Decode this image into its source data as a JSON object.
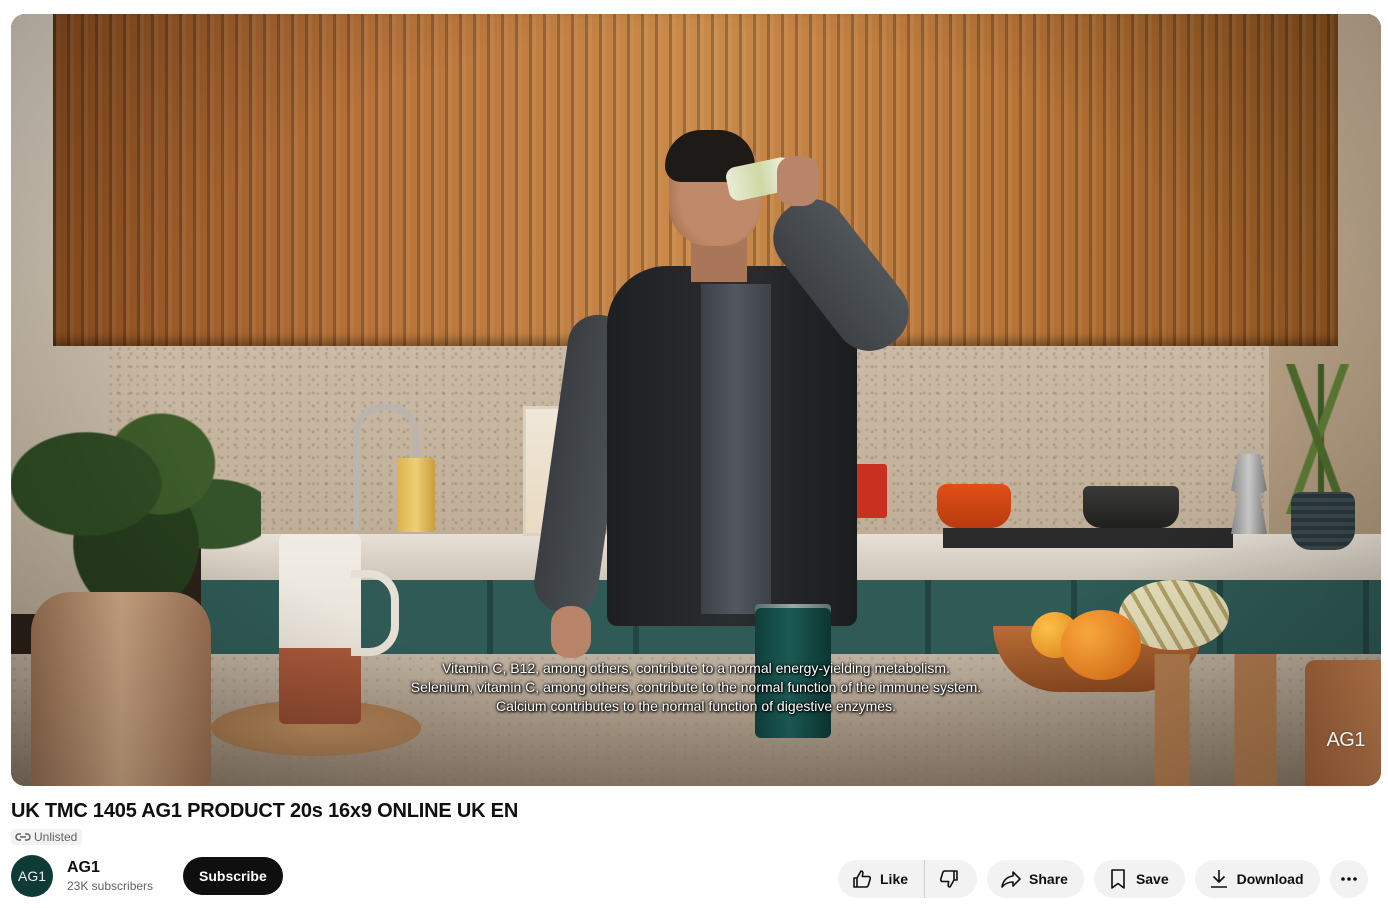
{
  "video": {
    "captions": [
      "Vitamin C, B12, among others, contribute to a normal energy-yielding metabolism.",
      "Selenium, vitamin C, among others, contribute to the normal function of the immune system.",
      "Calcium contributes to the normal function of digestive enzymes."
    ],
    "watermark": "AG1"
  },
  "meta": {
    "title": "UK TMC 1405 AG1 PRODUCT 20s 16x9 ONLINE UK EN",
    "visibility": "Unlisted"
  },
  "channel": {
    "avatar_text": "AG1",
    "name": "AG1",
    "subscribers": "23K subscribers",
    "subscribe_label": "Subscribe"
  },
  "actions": {
    "like_label": "Like",
    "share_label": "Share",
    "save_label": "Save",
    "download_label": "Download"
  },
  "icons": {
    "visibility": "link-icon",
    "like": "thumbs-up-icon",
    "dislike": "thumbs-down-icon",
    "share": "share-arrow-icon",
    "save": "bookmark-icon",
    "download": "download-icon",
    "more": "more-horizontal-icon"
  },
  "colors": {
    "subscribe_bg": "#0f0f0f",
    "pill_bg": "#f2f2f2",
    "avatar_bg": "#0f3b36"
  }
}
